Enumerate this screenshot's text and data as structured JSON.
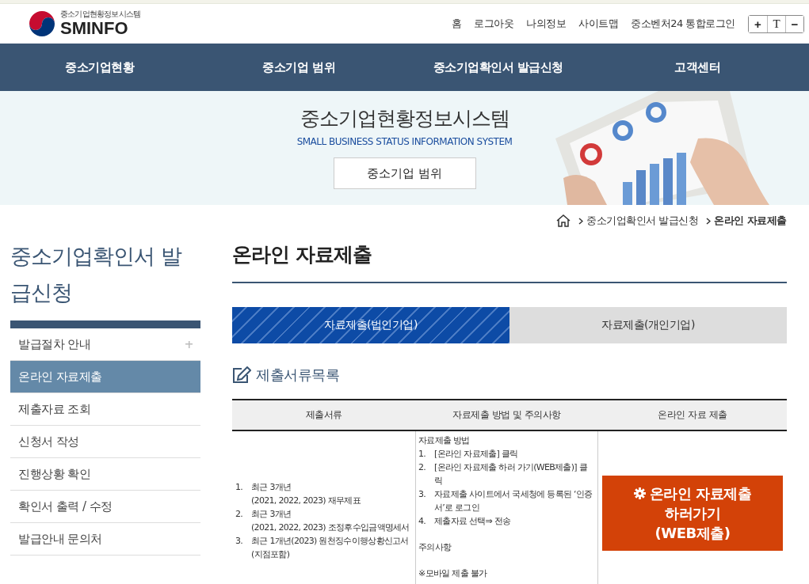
{
  "header": {
    "logo": {
      "subtitle": "중소기업현황정보시스템",
      "name": "SMINFO"
    },
    "utility_links": [
      "홈",
      "로그아웃",
      "나의정보",
      "사이트맵",
      "중소벤처24 통합로그인"
    ],
    "font_size_controls": [
      "+",
      "T",
      "−"
    ]
  },
  "nav": [
    "중소기업현황",
    "중소기업 범위",
    "중소기업확인서 발급신청",
    "고객센터"
  ],
  "banner": {
    "title": "중소기업현황정보시스템",
    "subtitle": "SMALL BUSINESS STATUS INFORMATION SYSTEM",
    "button": "중소기업 범위",
    "kind": "picture"
  },
  "breadcrumb": [
    "중소기업확인서 발급신청",
    "온라인 자료제출"
  ],
  "sidebar": {
    "title": "중소기업확인서 발급신청",
    "items": [
      {
        "label": "발급절차 안내",
        "selected": false,
        "expandable": true
      },
      {
        "label": "온라인 자료제출",
        "selected": true,
        "expandable": false
      },
      {
        "label": "제출자료 조회",
        "selected": false,
        "expandable": false
      },
      {
        "label": "신청서 작성",
        "selected": false,
        "expandable": false
      },
      {
        "label": "진행상황 확인",
        "selected": false,
        "expandable": false
      },
      {
        "label": "확인서 출력 / 수정",
        "selected": false,
        "expandable": false
      },
      {
        "label": "발급안내 문의처",
        "selected": false,
        "expandable": false
      }
    ]
  },
  "page_title": "온라인 자료제출",
  "tabs": [
    {
      "label": "자료제출(법인기업)",
      "selected": true
    },
    {
      "label": "자료제출(개인기업)",
      "selected": false
    }
  ],
  "section_title": "제출서류목록",
  "table": {
    "columns": [
      "제출서류",
      "자료제출 방법 및 주의사항",
      "온라인 자료 제출"
    ],
    "documents": [
      {
        "number": "1.",
        "lines": [
          "최근 3개년",
          "(2021, 2022, 2023) 재무제표"
        ]
      },
      {
        "number": "2.",
        "lines": [
          "최근 3개년",
          "(2021, 2022, 2023) 조정후수입금액명세서"
        ]
      },
      {
        "number": "3.",
        "lines": [
          "최근 1개년(2023) 원천징수이행상황신고서",
          "(지점포함)"
        ]
      }
    ],
    "method_heading": "자료제출 방법",
    "steps": [
      {
        "number": "1.",
        "text": "[온라인 자료제출] 클릭"
      },
      {
        "number": "2.",
        "text": "[온라인 자료제출 하러 가기(WEB제출)] 클릭"
      },
      {
        "number": "3.",
        "text": "자료제출 사이트에서 국세청에 등록된 ‘인증서’로 로그인"
      },
      {
        "number": "4.",
        "text": "제출자료 선택⇒ 전송"
      }
    ],
    "notes_heading": "주의사항",
    "notes": [
      "※모바일 제출 불가"
    ],
    "action": {
      "lines": [
        "온라인 자료제출",
        "하러가기",
        "(WEB제출)"
      ]
    }
  }
}
